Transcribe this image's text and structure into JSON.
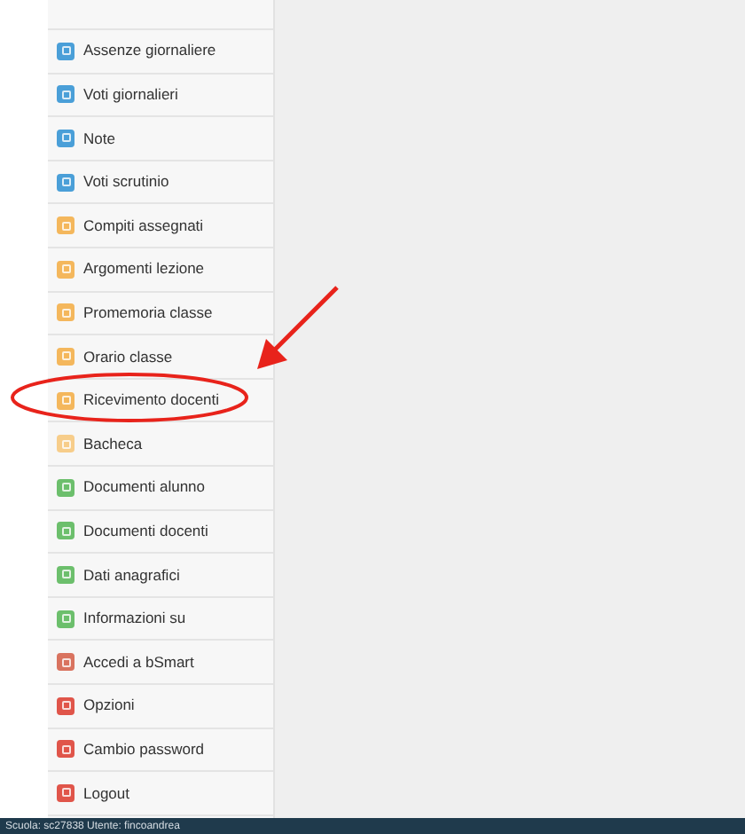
{
  "menu": [
    {
      "label": "Assenze giornaliere",
      "color": "#4a9fd8"
    },
    {
      "label": "Voti giornalieri",
      "color": "#4a9fd8"
    },
    {
      "label": "Note",
      "color": "#4a9fd8"
    },
    {
      "label": "Voti scrutinio",
      "color": "#4a9fd8"
    },
    {
      "label": "Compiti assegnati",
      "color": "#f4b75c"
    },
    {
      "label": "Argomenti lezione",
      "color": "#f4b75c"
    },
    {
      "label": "Promemoria classe",
      "color": "#f4b75c"
    },
    {
      "label": "Orario classe",
      "color": "#f4b75c"
    },
    {
      "label": "Ricevimento docenti",
      "color": "#f4b75c"
    },
    {
      "label": "Bacheca",
      "color": "#f7cd8a"
    },
    {
      "label": "Documenti alunno",
      "color": "#6cbf6c"
    },
    {
      "label": "Documenti docenti",
      "color": "#6cbf6c"
    },
    {
      "label": "Dati anagrafici",
      "color": "#6cbf6c"
    },
    {
      "label": "Informazioni su",
      "color": "#6cbf6c"
    },
    {
      "label": "Accedi a bSmart",
      "color": "#d9735f"
    },
    {
      "label": "Opzioni",
      "color": "#e0554a"
    },
    {
      "label": "Cambio password",
      "color": "#e0554a"
    },
    {
      "label": "Logout",
      "color": "#e0554a"
    }
  ],
  "status_bar": "Scuola: sc27838 Utente: fincoandrea"
}
